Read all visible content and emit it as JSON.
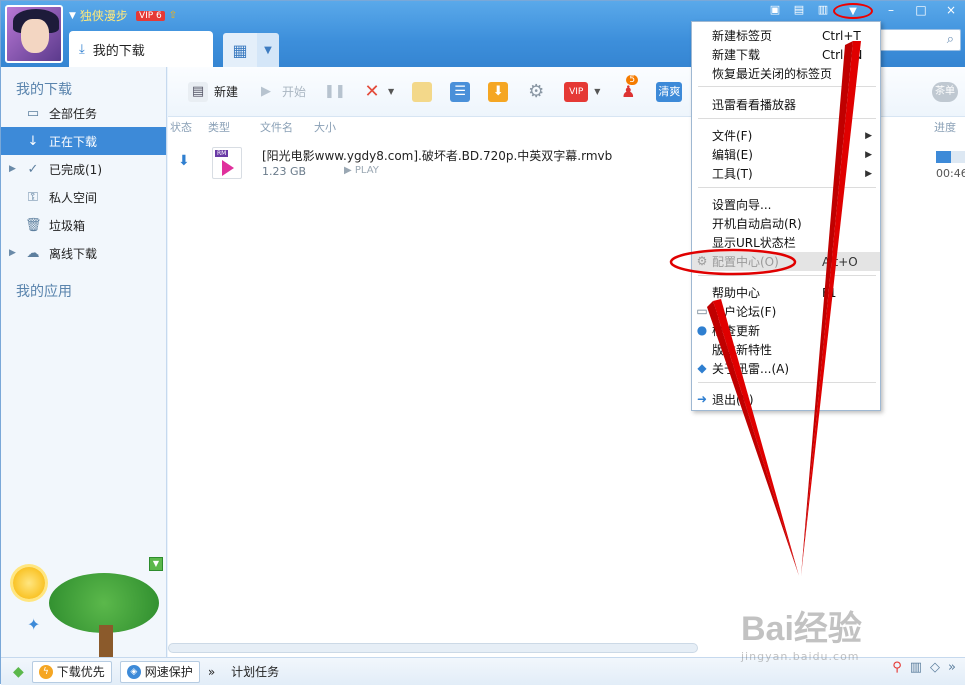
{
  "titlebar": {
    "username": "独侠漫步",
    "vip_badge": "VIP 6",
    "tab_title": "我的下载",
    "close_glyph": "×"
  },
  "sidebar": {
    "section_title": "我的下载",
    "items": [
      {
        "label": "全部任务",
        "icon": "document-icon"
      },
      {
        "label": "正在下载",
        "icon": "download-arrow-icon"
      },
      {
        "label": "已完成(1)",
        "icon": "checkmark-icon"
      },
      {
        "label": "私人空间",
        "icon": "lock-icon"
      },
      {
        "label": "垃圾箱",
        "icon": "trash-icon"
      },
      {
        "label": "离线下载",
        "icon": "cloud-download-icon"
      }
    ],
    "apps_title": "我的应用"
  },
  "toolbar": {
    "new_label": "新建",
    "start_label": "开始",
    "vip_label": "VIP",
    "vip_count": "5",
    "quality_label": "清爽",
    "clean_label": "茶单"
  },
  "columns": {
    "status": "状态",
    "type": "类型",
    "filename": "文件名",
    "size": "大小",
    "progress": "进度"
  },
  "task": {
    "file_badge": "RM",
    "filename": "[阳光电影www.ygdy8.com].破坏者.BD.720p.中英双字幕.rmvb",
    "size": "1.23 GB",
    "play_label": "PLAY",
    "eta": "00:46",
    "progress": 0.5
  },
  "menu": {
    "items": [
      {
        "label": "新建标签页",
        "shortcut": "Ctrl+T"
      },
      {
        "label": "新建下载",
        "shortcut": "Ctrl+N"
      },
      {
        "label": "恢复最近关闭的标签页",
        "shortcut": ""
      },
      {
        "label": "迅雷看看播放器",
        "shortcut": ""
      },
      {
        "label": "文件(F)",
        "shortcut": ""
      },
      {
        "label": "编辑(E)",
        "shortcut": ""
      },
      {
        "label": "工具(T)",
        "shortcut": ""
      },
      {
        "label": "设置向导...",
        "shortcut": ""
      },
      {
        "label": "开机自动启动(R)",
        "shortcut": ""
      },
      {
        "label": "显示URL状态栏",
        "shortcut": ""
      },
      {
        "label": "配置中心(O)",
        "shortcut": "Alt+O"
      },
      {
        "label": "帮助中心",
        "shortcut": "F1"
      },
      {
        "label": "用户论坛(F)",
        "shortcut": ""
      },
      {
        "label": "检查更新",
        "shortcut": ""
      },
      {
        "label": "版本新特性",
        "shortcut": ""
      },
      {
        "label": "关于迅雷...(A)",
        "shortcut": ""
      },
      {
        "label": "退出(X)",
        "shortcut": ""
      }
    ]
  },
  "statusbar": {
    "priority_label": "下载优先",
    "speed_label": "网速保护",
    "more_glyph": "»",
    "schedule_label": "计划任务"
  },
  "watermark": {
    "brand": "Bai经验",
    "url": "jingyan.baidu.com"
  },
  "colors": {
    "accent": "#3d8ad8",
    "annotation": "#e00000"
  }
}
